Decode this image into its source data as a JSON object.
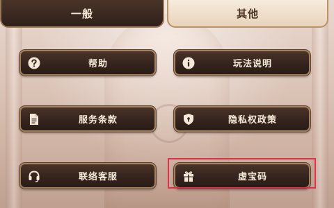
{
  "tabs": [
    {
      "label": "一般",
      "active": false
    },
    {
      "label": "其他",
      "active": true
    }
  ],
  "buttons": {
    "help": {
      "label": "帮助",
      "icon": "question-circle-icon"
    },
    "gameplay": {
      "label": "玩法说明",
      "icon": "info-circle-icon"
    },
    "terms": {
      "label": "服务条款",
      "icon": "document-icon"
    },
    "privacy": {
      "label": "隐私权政策",
      "icon": "shield-icon"
    },
    "support": {
      "label": "联络客服",
      "icon": "headset-icon"
    },
    "code": {
      "label": "虚宝码",
      "icon": "gift-icon",
      "highlighted": true
    }
  },
  "colors": {
    "highlight_border": "#e0304a",
    "button_text": "#f4e9d8",
    "button_fill": "#35241d",
    "button_border": "#a3805e"
  }
}
